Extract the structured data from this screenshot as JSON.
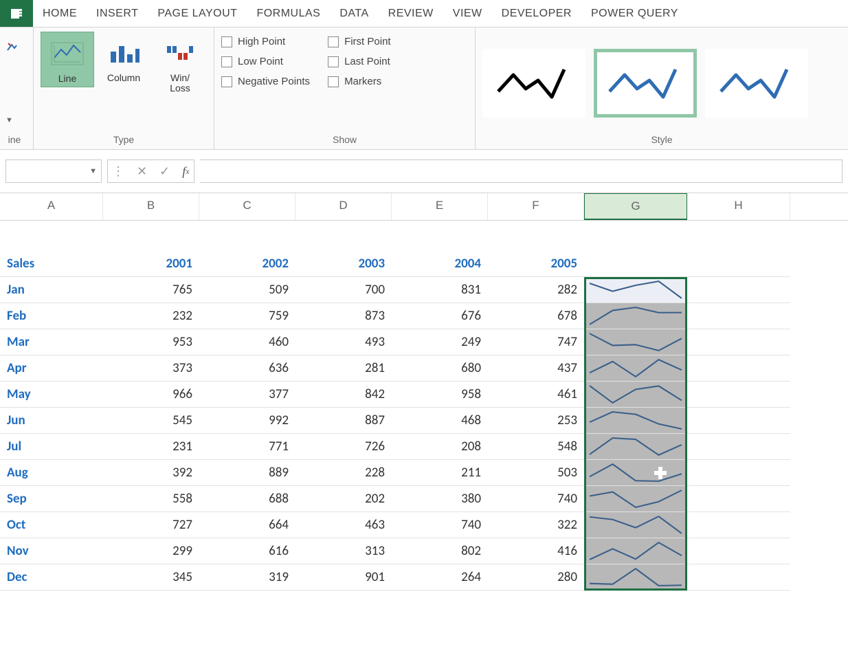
{
  "ribbon": {
    "tabs": [
      "HOME",
      "INSERT",
      "PAGE LAYOUT",
      "FORMULAS",
      "DATA",
      "REVIEW",
      "VIEW",
      "DEVELOPER",
      "POWER QUERY"
    ],
    "group_labels": {
      "edit": "ine",
      "type": "Type",
      "show": "Show",
      "style": "Style"
    },
    "type_buttons": {
      "line": {
        "label": "Line",
        "selected": true
      },
      "column": {
        "label": "Column",
        "selected": false
      },
      "winloss": {
        "label": "Win/\nLoss",
        "selected": false
      }
    },
    "show_checks": [
      {
        "label": "High Point",
        "checked": false
      },
      {
        "label": "First Point",
        "checked": false
      },
      {
        "label": "Low Point",
        "checked": false
      },
      {
        "label": "Last Point",
        "checked": false
      },
      {
        "label": "Negative Points",
        "checked": false
      },
      {
        "label": "Markers",
        "checked": false
      }
    ],
    "styles": [
      {
        "color": "#000000",
        "selected": false
      },
      {
        "color": "#2f6db3",
        "selected": true
      },
      {
        "color": "#2f6db3",
        "selected": false
      }
    ]
  },
  "namebar": {
    "name": "",
    "formula": ""
  },
  "columns": [
    "A",
    "B",
    "C",
    "D",
    "E",
    "F",
    "G",
    "H"
  ],
  "selected_column": "G",
  "sheet": {
    "header_label": "Sales",
    "years": [
      "2001",
      "2002",
      "2003",
      "2004",
      "2005"
    ],
    "rows": [
      {
        "month": "Jan",
        "values": [
          765,
          509,
          700,
          831,
          282
        ]
      },
      {
        "month": "Feb",
        "values": [
          232,
          759,
          873,
          676,
          678
        ]
      },
      {
        "month": "Mar",
        "values": [
          953,
          460,
          493,
          249,
          747
        ]
      },
      {
        "month": "Apr",
        "values": [
          373,
          636,
          281,
          680,
          437
        ]
      },
      {
        "month": "May",
        "values": [
          966,
          377,
          842,
          958,
          461
        ]
      },
      {
        "month": "Jun",
        "values": [
          545,
          992,
          887,
          468,
          253
        ]
      },
      {
        "month": "Jul",
        "values": [
          231,
          771,
          726,
          208,
          548
        ]
      },
      {
        "month": "Aug",
        "values": [
          392,
          889,
          228,
          211,
          503
        ]
      },
      {
        "month": "Sep",
        "values": [
          558,
          688,
          202,
          380,
          740
        ]
      },
      {
        "month": "Oct",
        "values": [
          727,
          664,
          463,
          740,
          322
        ]
      },
      {
        "month": "Nov",
        "values": [
          299,
          616,
          313,
          802,
          416
        ]
      },
      {
        "month": "Dec",
        "values": [
          345,
          319,
          901,
          264,
          280
        ]
      }
    ]
  },
  "chart_data": {
    "type": "line",
    "note": "12 sparklines in column G, one per month row, each plotting that month's values across 2001–2005",
    "x": [
      "2001",
      "2002",
      "2003",
      "2004",
      "2005"
    ],
    "series": [
      {
        "name": "Jan",
        "values": [
          765,
          509,
          700,
          831,
          282
        ]
      },
      {
        "name": "Feb",
        "values": [
          232,
          759,
          873,
          676,
          678
        ]
      },
      {
        "name": "Mar",
        "values": [
          953,
          460,
          493,
          249,
          747
        ]
      },
      {
        "name": "Apr",
        "values": [
          373,
          636,
          281,
          680,
          437
        ]
      },
      {
        "name": "May",
        "values": [
          966,
          377,
          842,
          958,
          461
        ]
      },
      {
        "name": "Jun",
        "values": [
          545,
          992,
          887,
          468,
          253
        ]
      },
      {
        "name": "Jul",
        "values": [
          231,
          771,
          726,
          208,
          548
        ]
      },
      {
        "name": "Aug",
        "values": [
          392,
          889,
          228,
          211,
          503
        ]
      },
      {
        "name": "Sep",
        "values": [
          558,
          688,
          202,
          380,
          740
        ]
      },
      {
        "name": "Oct",
        "values": [
          727,
          664,
          463,
          740,
          322
        ]
      },
      {
        "name": "Nov",
        "values": [
          299,
          616,
          313,
          802,
          416
        ]
      },
      {
        "name": "Dec",
        "values": [
          345,
          319,
          901,
          264,
          280
        ]
      }
    ]
  }
}
